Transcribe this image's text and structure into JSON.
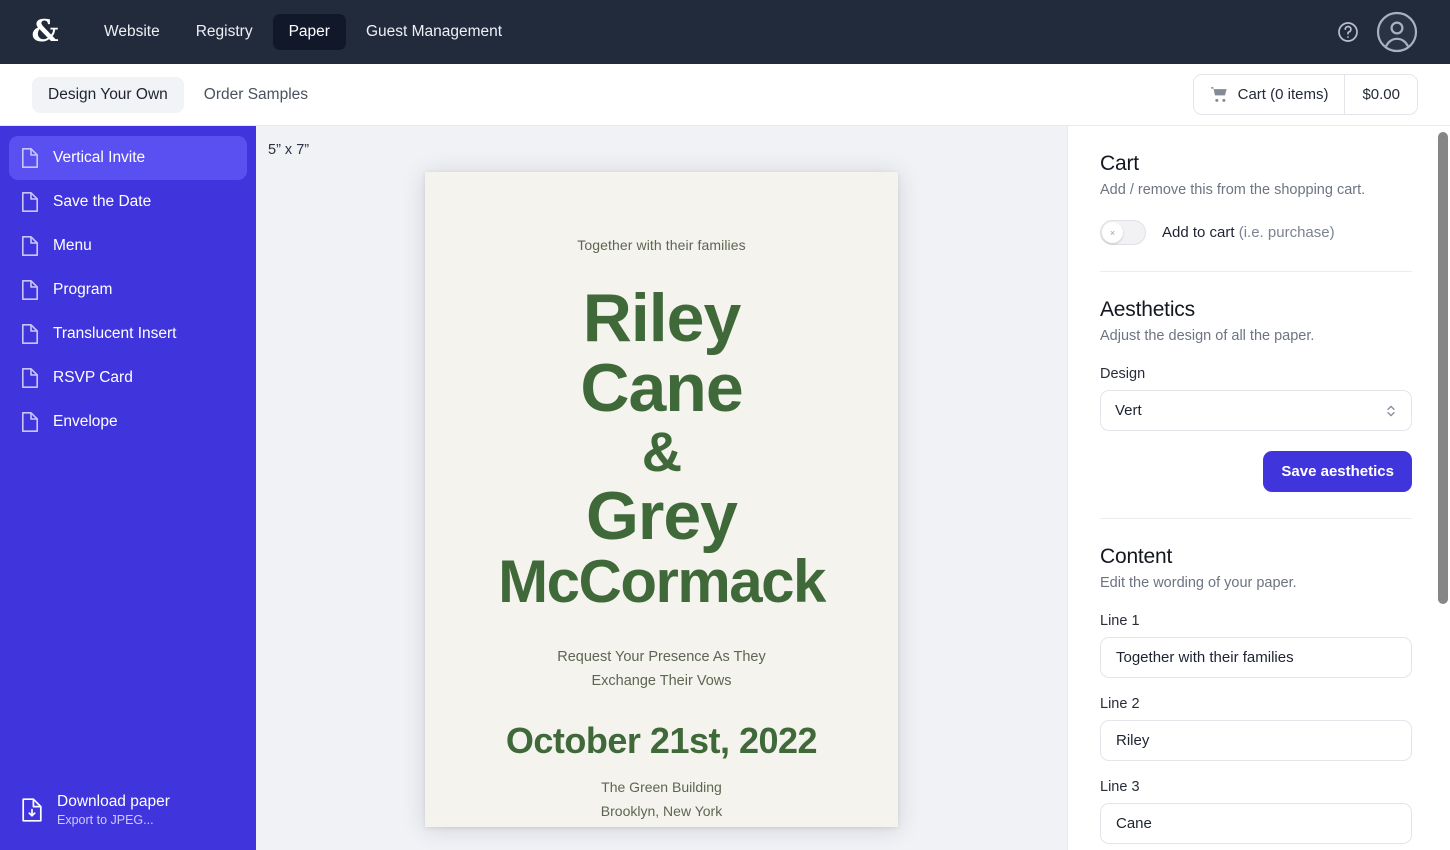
{
  "topnav": {
    "logo": "&",
    "links": [
      {
        "label": "Website",
        "active": false
      },
      {
        "label": "Registry",
        "active": false
      },
      {
        "label": "Paper",
        "active": true
      },
      {
        "label": "Guest Management",
        "active": false
      }
    ],
    "help_icon": "help-circle-icon",
    "avatar_icon": "user-avatar-icon",
    "bg_color": "#222b3c"
  },
  "subbar": {
    "tabs": [
      {
        "label": "Design Your Own",
        "active": true
      },
      {
        "label": "Order Samples",
        "active": false
      }
    ],
    "cart_icon": "shopping-cart-icon",
    "cart_label": "Cart (0 items)",
    "cart_total": "$0.00"
  },
  "sidebar": {
    "accent_color": "#4034dd",
    "active_color": "#5a4ff0",
    "items": [
      {
        "label": "Vertical Invite",
        "active": true
      },
      {
        "label": "Save the Date",
        "active": false
      },
      {
        "label": "Menu",
        "active": false
      },
      {
        "label": "Program",
        "active": false
      },
      {
        "label": "Translucent Insert",
        "active": false
      },
      {
        "label": "RSVP Card",
        "active": false
      },
      {
        "label": "Envelope",
        "active": false
      }
    ],
    "download": {
      "title": "Download paper",
      "subtitle": "Export to JPEG...",
      "icon": "download-document-icon"
    }
  },
  "canvas": {
    "size_label": "5” x 7”",
    "bg_color": "#f1f2f6",
    "paper": {
      "bg_color": "#f4f3ee",
      "text_color": "#40693a",
      "muted_color": "#5d6652",
      "line1": "Together with their families",
      "name1": "Riley",
      "name2": "Cane",
      "ampersand": "&",
      "name3": "Grey",
      "name4": "McCormack",
      "mid_line1": "Request Your Presence As They",
      "mid_line2": "Exchange Their Vows",
      "date": "October 21st, 2022",
      "venue": "The Green Building",
      "city": "Brooklyn, New York"
    }
  },
  "rightpanel": {
    "cart": {
      "title": "Cart",
      "subtitle": "Add / remove this from the shopping cart.",
      "toggle_state": "off",
      "toggle_knob_glyph": "×",
      "toggle_label_strong": "Add to cart ",
      "toggle_label_muted": "(i.e. purchase)"
    },
    "aesthetics": {
      "title": "Aesthetics",
      "subtitle": "Adjust the design of all the paper.",
      "design_label": "Design",
      "design_value": "Vert",
      "save_button": "Save aesthetics",
      "button_color": "#4034dd"
    },
    "content": {
      "title": "Content",
      "subtitle": "Edit the wording of your paper.",
      "fields": [
        {
          "label": "Line 1",
          "value": "Together with their families"
        },
        {
          "label": "Line 2",
          "value": "Riley"
        },
        {
          "label": "Line 3",
          "value": "Cane"
        }
      ]
    }
  }
}
